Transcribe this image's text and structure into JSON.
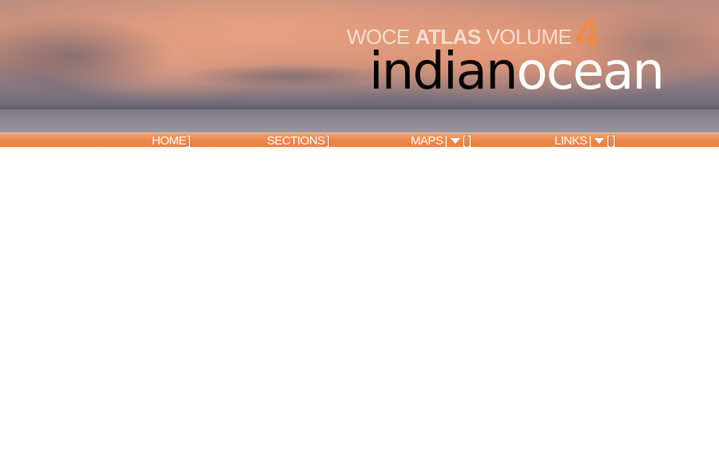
{
  "header": {
    "line1_part1": "WOCE",
    "line1_part2": "ATLAS",
    "line1_part3": "VOLUME",
    "volume_number": "4",
    "line2_part1": "indian",
    "line2_part2": "ocean"
  },
  "nav": {
    "items": [
      {
        "label": "HOME",
        "bracket": "]"
      },
      {
        "label": "SECTIONS",
        "bracket": "]"
      },
      {
        "label": "MAPS",
        "sep": "|",
        "bracket": "[ ]"
      },
      {
        "label": "LINKS",
        "sep": "|",
        "bracket": "[ ]"
      }
    ]
  },
  "colors": {
    "accent": "#ee8a4e",
    "nav_bar": "#ee8a4e",
    "title_dark": "#050505",
    "title_light": "#ffffff",
    "subtitle": "#f6dccf"
  },
  "icons": {
    "dropdown": "chevron-down-icon"
  }
}
